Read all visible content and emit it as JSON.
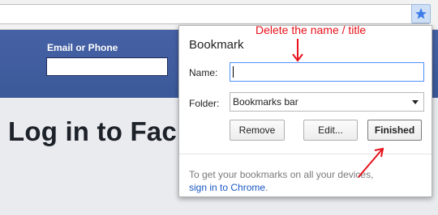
{
  "browser": {
    "bookmark_star_icon": "star-icon"
  },
  "page": {
    "email_label": "Email or Phone",
    "login_title": "Log in to Fac"
  },
  "bookmark_popup": {
    "title": "Bookmark",
    "name_label": "Name:",
    "name_value": "",
    "folder_label": "Folder:",
    "folder_value": "Bookmarks bar",
    "remove_label": "Remove",
    "edit_label": "Edit...",
    "finished_label": "Finished",
    "footer_text": "To get your bookmarks on all your devices,",
    "signin_link": "sign in to Chrome",
    "signin_suffix": "."
  },
  "annotation": {
    "text": "Delete the name / title",
    "color": "#e8101a"
  }
}
